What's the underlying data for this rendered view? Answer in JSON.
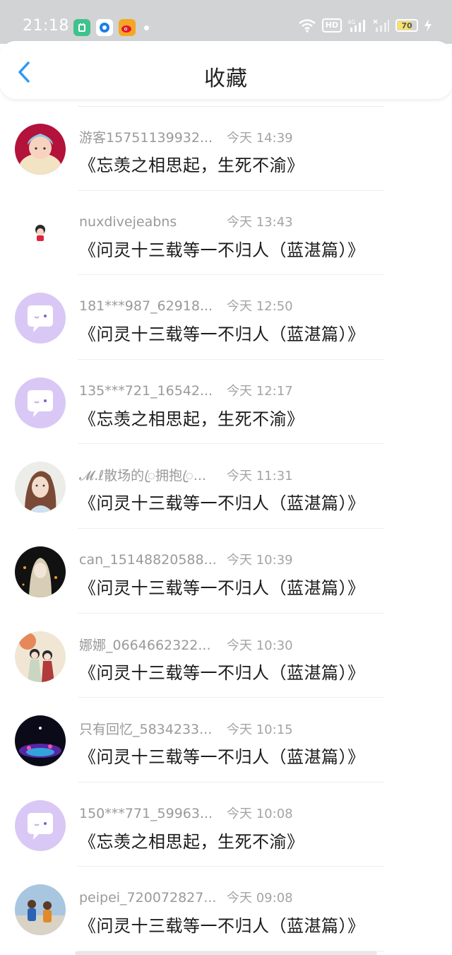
{
  "status_bar": {
    "time": "21:18",
    "battery": "70",
    "network": "4G",
    "hd_label": "HD"
  },
  "header": {
    "title": "收藏"
  },
  "items": [
    {
      "user": "游客15751139932...",
      "time": "今天 14:39",
      "book": "《忘羡之相思起，生死不渝》",
      "avatar": "baby-photo"
    },
    {
      "user": "nuxdivejeabns",
      "time": "今天 13:43",
      "book": "《问灵十三载等一不归人（蓝湛篇）》",
      "avatar": "cartoon-girl"
    },
    {
      "user": "181***987_62918...",
      "time": "今天 12:50",
      "book": "《问灵十三载等一不归人（蓝湛篇）》",
      "avatar": "default-chat"
    },
    {
      "user": "135***721_16542...",
      "time": "今天 12:17",
      "book": "《忘羡之相思起，生死不渝》",
      "avatar": "default-chat"
    },
    {
      "user": "𝓜.ℓ散场的ꦿ拥抱ꦿ...",
      "time": "今天 11:31",
      "book": "《问灵十三载等一不归人（蓝湛篇）》",
      "avatar": "selfie-girl"
    },
    {
      "user": "can_15148820588...",
      "time": "今天 10:39",
      "book": "《问灵十三载等一不归人（蓝湛篇）》",
      "avatar": "anime-dark"
    },
    {
      "user": "娜娜_0664662322...",
      "time": "今天 10:30",
      "book": "《问灵十三载等一不归人（蓝湛篇）》",
      "avatar": "anime-couple"
    },
    {
      "user": "只有回忆_5834233...",
      "time": "今天 10:15",
      "book": "《问灵十三载等一不归人（蓝湛篇）》",
      "avatar": "night-lights"
    },
    {
      "user": "150***771_59963...",
      "time": "今天 10:08",
      "book": "《忘羡之相思起，生死不渝》",
      "avatar": "default-chat"
    },
    {
      "user": "peipei_720072827...",
      "time": "今天 09:08",
      "book": "《问灵十三载等一不归人（蓝湛篇）》",
      "avatar": "kids-outdoor"
    }
  ],
  "colors": {
    "accent": "#2a9af3",
    "default_avatar": "#d9c8f5"
  }
}
